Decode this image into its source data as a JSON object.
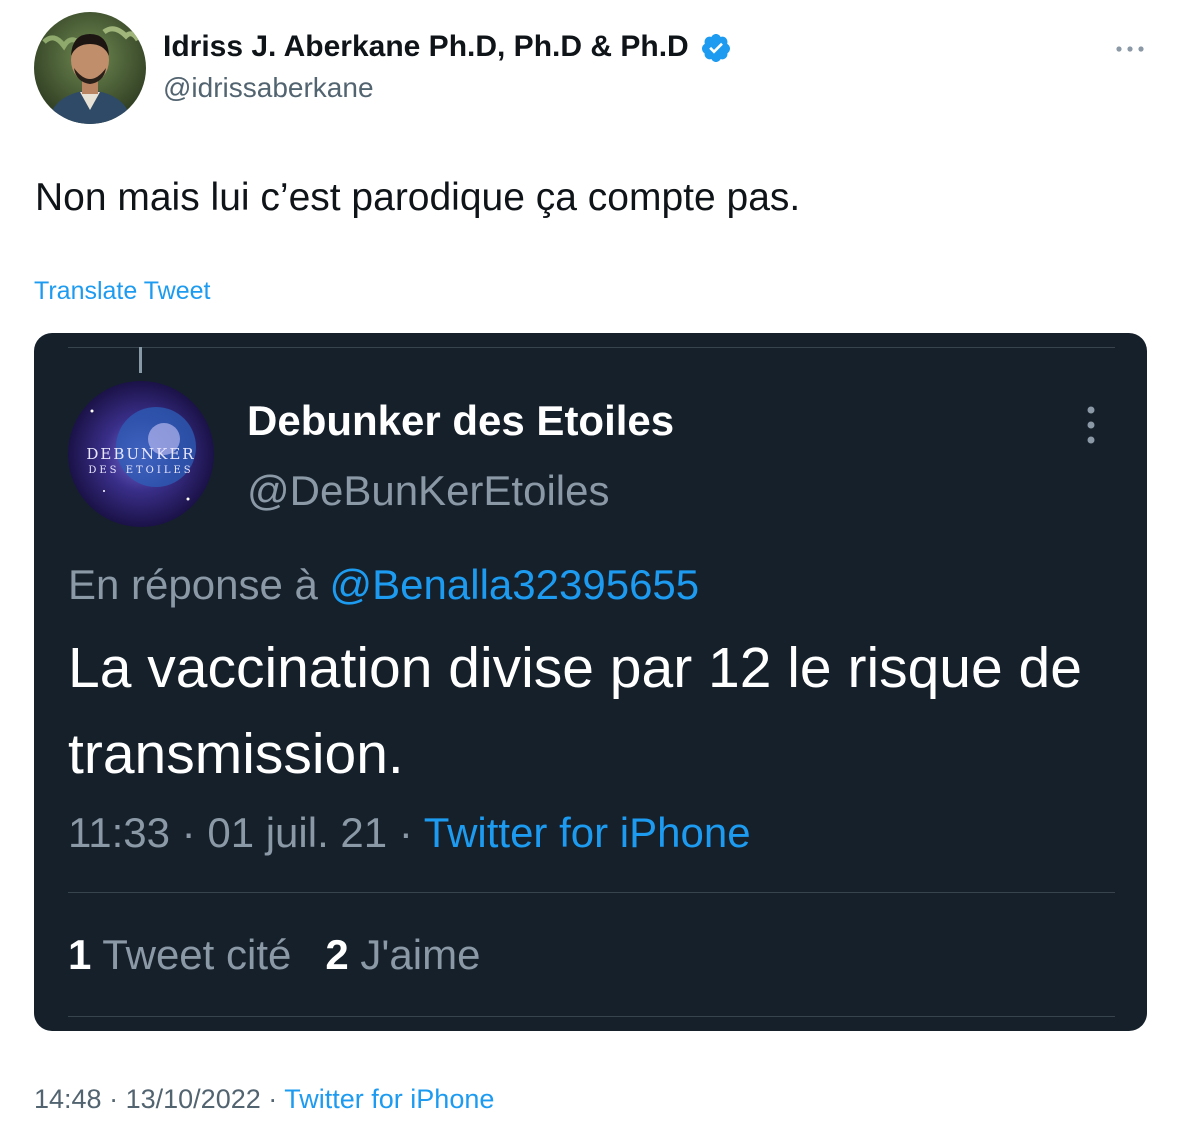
{
  "author": {
    "name": "Idriss J. Aberkane Ph.D, Ph.D & Ph.D",
    "handle": "@idrissaberkane",
    "verified": true
  },
  "tweet": {
    "text": "Non mais lui c’est parodique ça compte pas.",
    "translate_label": "Translate Tweet",
    "time": "14:48",
    "date": "13/10/2022",
    "source": "Twitter for iPhone",
    "separator": "·"
  },
  "quoted": {
    "name": "Debunker des Etoiles",
    "handle": "@DeBunKerEtoiles",
    "reply_prefix": "En réponse à",
    "reply_mention": "@Benalla32395655",
    "text": "La vaccination divise par 12 le risque de transmission.",
    "time": "11:33",
    "date": "01 juil. 21",
    "source": "Twitter for iPhone",
    "separator": "·",
    "quote_count": "1",
    "quote_label": "Tweet cité",
    "like_count": "2",
    "like_label": "J'aime",
    "avatar_text_line1": "DEBUNKER",
    "avatar_text_line2": "DES ETOILES"
  },
  "icons": {
    "verified": "verified-badge-icon",
    "more": "more-horizontal-icon",
    "quoted_more": "more-vertical-icon"
  },
  "colors": {
    "link": "#1d9bf0",
    "text": "#0f1419",
    "muted": "#536471",
    "dark_bg": "#15202b",
    "dark_muted": "#8b98a5"
  }
}
